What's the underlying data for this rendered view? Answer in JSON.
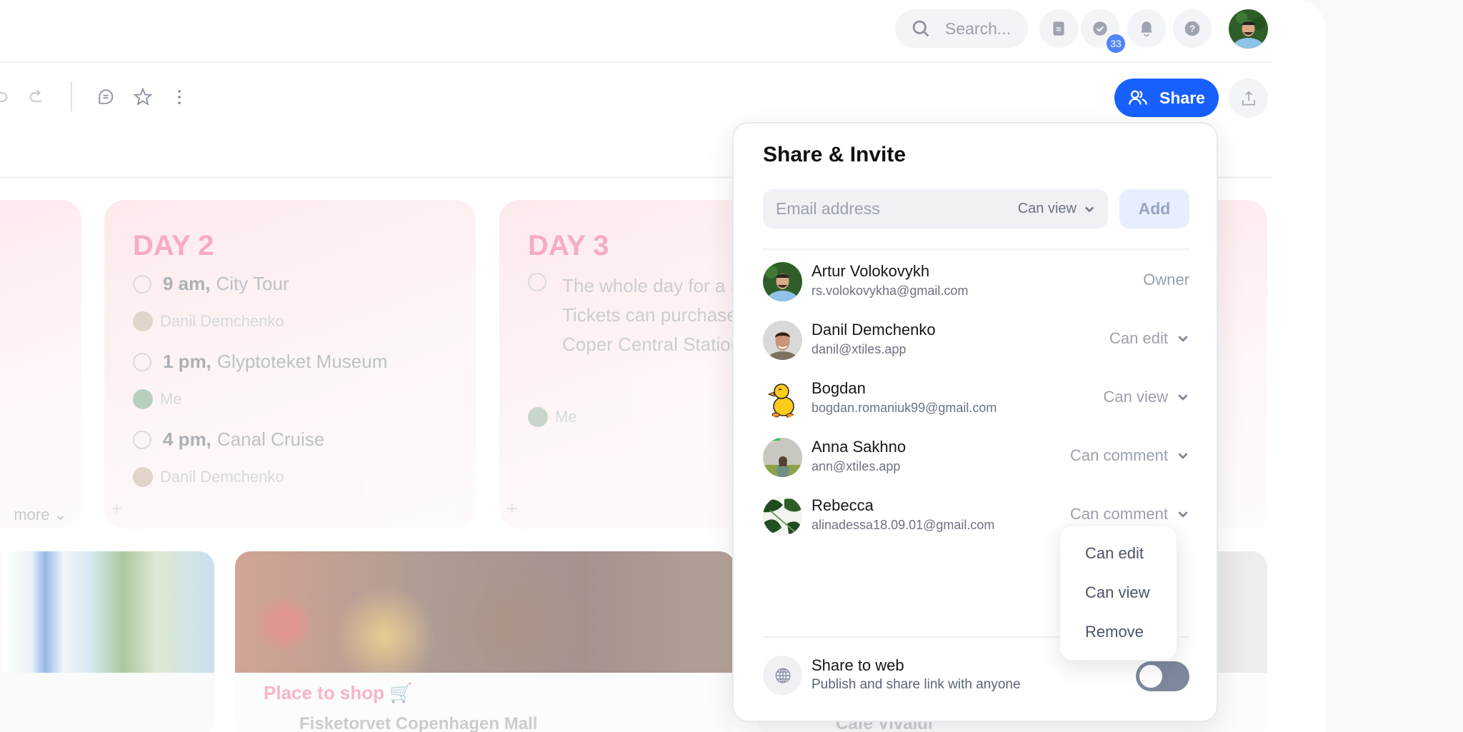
{
  "header": {
    "search_placeholder": "Search...",
    "tasks_badge": "33",
    "icons": [
      "search-icon",
      "notes-icon",
      "tasks-check-icon",
      "bell-icon",
      "help-icon",
      "user-avatar"
    ]
  },
  "toolbar": {
    "share_label": "Share",
    "icons": [
      "undo-icon",
      "redo-icon",
      "comment-icon",
      "star-icon",
      "more-vertical-icon",
      "export-icon",
      "people-icon"
    ]
  },
  "board": {
    "day1": {
      "more_label": "more"
    },
    "day2": {
      "title": "DAY 2",
      "tasks": [
        {
          "time": "9 am,",
          "text": "City Tour",
          "assignee": "Danil Demchenko"
        },
        {
          "time": "1 pm,",
          "text": "Glyptoteket Museum",
          "assignee": "Me"
        },
        {
          "time": "4 pm,",
          "text": " Canal Cruise",
          "assignee": "Danil Demchenko"
        }
      ]
    },
    "day3": {
      "title": "DAY 3",
      "text": "The whole day for a Malmö. Tickets can purchased at Coper Central Station.",
      "assignee": "Me"
    },
    "shop_card": {
      "title": "Place to shop 🛒",
      "item": "Fisketorvet Copenhagen Mall"
    },
    "cafe_card": {
      "item": "Café Vivaldi"
    }
  },
  "dialog": {
    "title": "Share & Invite",
    "email_placeholder": "Email address",
    "invite_permission": "Can view",
    "add_label": "Add",
    "members": [
      {
        "name": "Artur Volokovykh",
        "email": "rs.volokovykha@gmail.com",
        "role": "Owner"
      },
      {
        "name": "Danil Demchenko",
        "email": "danil@xtiles.app",
        "role": "Can edit"
      },
      {
        "name": "Bogdan",
        "email": "bogdan.romaniuk99@gmail.com",
        "role": "Can view"
      },
      {
        "name": "Anna Sakhno",
        "email": "ann@xtiles.app",
        "role": "Can comment"
      },
      {
        "name": "Rebecca",
        "email": "alinadessa18.09.01@gmail.com",
        "role": "Can comment"
      }
    ],
    "role_menu": [
      "Can edit",
      "Can view",
      "Remove"
    ],
    "share_web": {
      "title": "Share to web",
      "subtitle": "Publish and share link with anyone",
      "enabled": false
    }
  },
  "colors": {
    "accent": "#1760ff",
    "badge": "#4f86f7",
    "day_title": "#f06a8f",
    "toggle_off": "#7e889c"
  }
}
